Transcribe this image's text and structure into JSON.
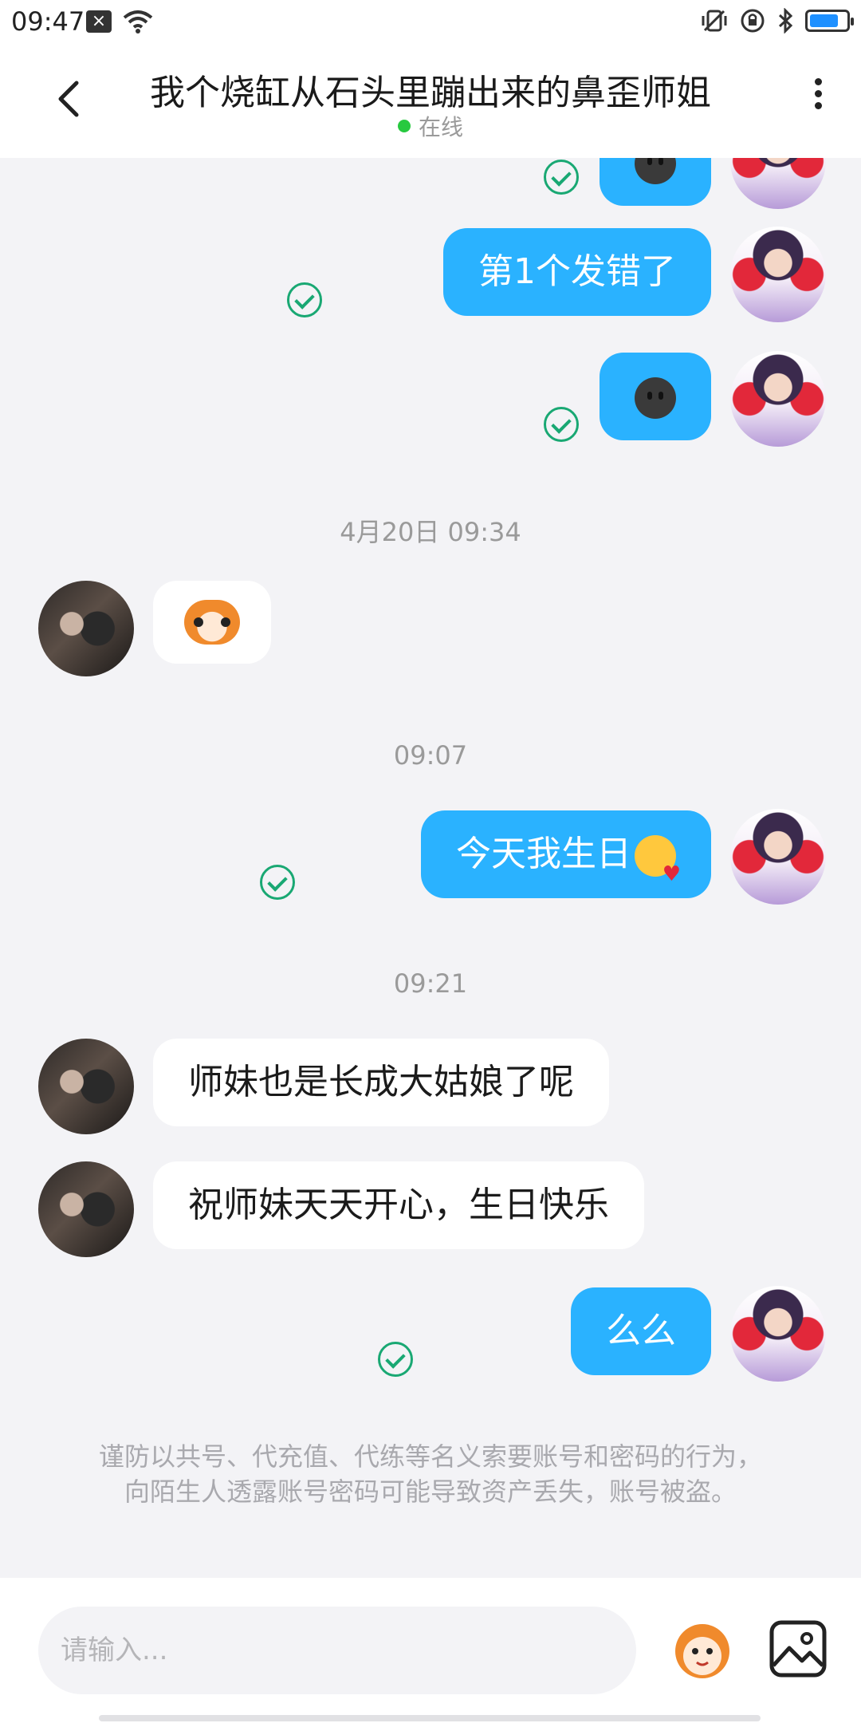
{
  "status_bar": {
    "time": "09:47",
    "left_icons": [
      "close-box-icon",
      "wifi-icon"
    ],
    "right_icons": [
      "vibrate-icon",
      "lock-rotation-icon",
      "bluetooth-icon",
      "battery-icon"
    ]
  },
  "header": {
    "title": "我个烧缸从石头里蹦出来的鼻歪师姐",
    "status": "在线",
    "status_color": "#27C93F"
  },
  "messages": [
    {
      "type": "image",
      "from": "me",
      "content": "dark-smiley-emoji",
      "status": "read"
    },
    {
      "type": "text",
      "from": "me",
      "text": "第1个发错了",
      "status": "read"
    },
    {
      "type": "image",
      "from": "me",
      "content": "dark-smiley-emoji",
      "status": "read"
    },
    {
      "type": "timestamp",
      "text": "4月20日 09:34"
    },
    {
      "type": "sticker",
      "from": "them",
      "content": "monkey-sticker"
    },
    {
      "type": "timestamp",
      "text": "09:07"
    },
    {
      "type": "text",
      "from": "me",
      "text": "今天我生日",
      "emoji": "kissing-face-emoji",
      "status": "read"
    },
    {
      "type": "timestamp",
      "text": "09:21"
    },
    {
      "type": "text",
      "from": "them",
      "text": "师妹也是长成大姑娘了呢"
    },
    {
      "type": "text",
      "from": "them",
      "text": "祝师妹天天开心，生日快乐"
    },
    {
      "type": "text",
      "from": "me",
      "text": "么么",
      "status": "read"
    }
  ],
  "notice": "谨防以共号、代充值、代练等名义索要账号和密码的行为，向陌生人透露账号密码可能导致资产丢失，账号被盗。",
  "input_bar": {
    "placeholder": "请输入...",
    "buttons": [
      "sticker-icon",
      "image-icon"
    ]
  },
  "colors": {
    "my_bubble": "#2AB2FF",
    "their_bubble": "#FFFFFF",
    "background": "#F3F3F6",
    "check": "#19A873"
  }
}
